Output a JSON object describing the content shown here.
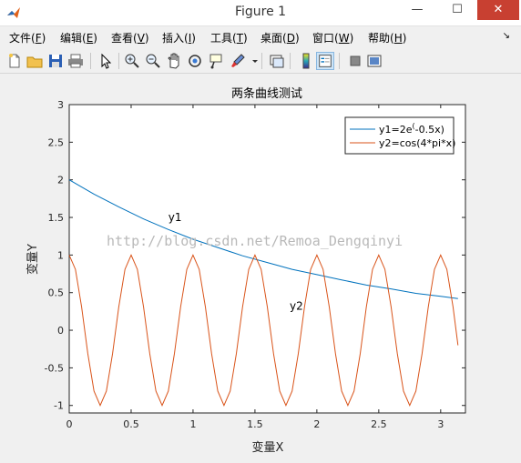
{
  "window": {
    "title": "Figure 1",
    "minimize_glyph": "—",
    "maximize_glyph": "☐",
    "close_glyph": "✕"
  },
  "menubar": {
    "items": [
      {
        "label": "文件(",
        "key": "F",
        "end": ")"
      },
      {
        "label": "编辑(",
        "key": "E",
        "end": ")"
      },
      {
        "label": "查看(",
        "key": "V",
        "end": ")"
      },
      {
        "label": "插入(",
        "key": "I",
        "end": ")"
      },
      {
        "label": "工具(",
        "key": "T",
        "end": ")"
      },
      {
        "label": "桌面(",
        "key": "D",
        "end": ")"
      },
      {
        "label": "窗口(",
        "key": "W",
        "end": ")"
      },
      {
        "label": "帮助(",
        "key": "H",
        "end": ")"
      }
    ],
    "overflow_glyph": "↘"
  },
  "toolbar": {
    "icons": [
      "new-figure-icon",
      "open-file-icon",
      "save-icon",
      "print-icon",
      "pointer-icon",
      "zoom-in-icon",
      "zoom-out-icon",
      "pan-hand-icon",
      "rotate-3d-icon",
      "data-cursor-icon",
      "brush-icon",
      "brush-dropdown-icon",
      "link-plot-icon",
      "colorbar-icon",
      "legend-icon",
      "hide-plot-tools-icon",
      "show-plot-tools-icon"
    ]
  },
  "watermark": "http://blog.csdn.net/Remoa_Dengqinyi",
  "chart_data": {
    "type": "line",
    "title": "两条曲线测试",
    "xlabel": "变量X",
    "ylabel": "变量Y",
    "xlim": [
      0,
      3.2
    ],
    "ylim": [
      -1.1,
      3
    ],
    "xticks": [
      0,
      0.5,
      1,
      1.5,
      2,
      2.5,
      3
    ],
    "xtick_labels": [
      "0",
      "0.5",
      "1",
      "1.5",
      "2",
      "2.5",
      "3"
    ],
    "yticks": [
      -1,
      -0.5,
      0,
      0.5,
      1,
      1.5,
      2,
      2.5,
      3
    ],
    "ytick_labels": [
      "-1",
      "-0.5",
      "0",
      "0.5",
      "1",
      "1.5",
      "2",
      "2.5",
      "3"
    ],
    "grid": false,
    "legend_position": "top-right",
    "series": [
      {
        "name": "y1=2e^(-0.5x)",
        "legend_main": "y1=2e",
        "legend_sup": "(",
        "legend_tail": "-0.5x)",
        "color": "#0072bd",
        "x": [
          0,
          0.2,
          0.4,
          0.6,
          0.8,
          1.0,
          1.2,
          1.4,
          1.6,
          1.8,
          2.0,
          2.2,
          2.4,
          2.6,
          2.8,
          3.0,
          3.14
        ],
        "y": [
          2.0,
          1.81,
          1.64,
          1.48,
          1.34,
          1.21,
          1.1,
          0.99,
          0.9,
          0.81,
          0.74,
          0.67,
          0.6,
          0.55,
          0.49,
          0.45,
          0.42
        ]
      },
      {
        "name": "y2=cos(4*pi*x)",
        "legend_main": "y2=cos(4*pi*x)",
        "color": "#d95319",
        "x": [
          0,
          0.05,
          0.1,
          0.15,
          0.2,
          0.25,
          0.3,
          0.35,
          0.4,
          0.45,
          0.5,
          0.55,
          0.6,
          0.65,
          0.7,
          0.75,
          0.8,
          0.85,
          0.9,
          0.95,
          1.0,
          1.05,
          1.1,
          1.15,
          1.2,
          1.25,
          1.3,
          1.35,
          1.4,
          1.45,
          1.5,
          1.55,
          1.6,
          1.65,
          1.7,
          1.75,
          1.8,
          1.85,
          1.9,
          1.95,
          2.0,
          2.05,
          2.1,
          2.15,
          2.2,
          2.25,
          2.3,
          2.35,
          2.4,
          2.45,
          2.5,
          2.55,
          2.6,
          2.65,
          2.7,
          2.75,
          2.8,
          2.85,
          2.9,
          2.95,
          3.0,
          3.05,
          3.1,
          3.14
        ],
        "y": [
          1.0,
          0.81,
          0.31,
          -0.31,
          -0.81,
          -1.0,
          -0.81,
          -0.31,
          0.31,
          0.81,
          1.0,
          0.81,
          0.31,
          -0.31,
          -0.81,
          -1.0,
          -0.81,
          -0.31,
          0.31,
          0.81,
          1.0,
          0.81,
          0.31,
          -0.31,
          -0.81,
          -1.0,
          -0.81,
          -0.31,
          0.31,
          0.81,
          1.0,
          0.81,
          0.31,
          -0.31,
          -0.81,
          -1.0,
          -0.81,
          -0.31,
          0.31,
          0.81,
          1.0,
          0.81,
          0.31,
          -0.31,
          -0.81,
          -1.0,
          -0.81,
          -0.31,
          0.31,
          0.81,
          1.0,
          0.81,
          0.31,
          -0.31,
          -0.81,
          -1.0,
          -0.81,
          -0.31,
          0.31,
          0.81,
          1.0,
          0.81,
          0.31,
          -0.2
        ]
      }
    ],
    "annotations": [
      {
        "text": "y1",
        "x": 0.8,
        "y": 1.45
      },
      {
        "text": "y2",
        "x": 1.78,
        "y": 0.27
      }
    ]
  }
}
